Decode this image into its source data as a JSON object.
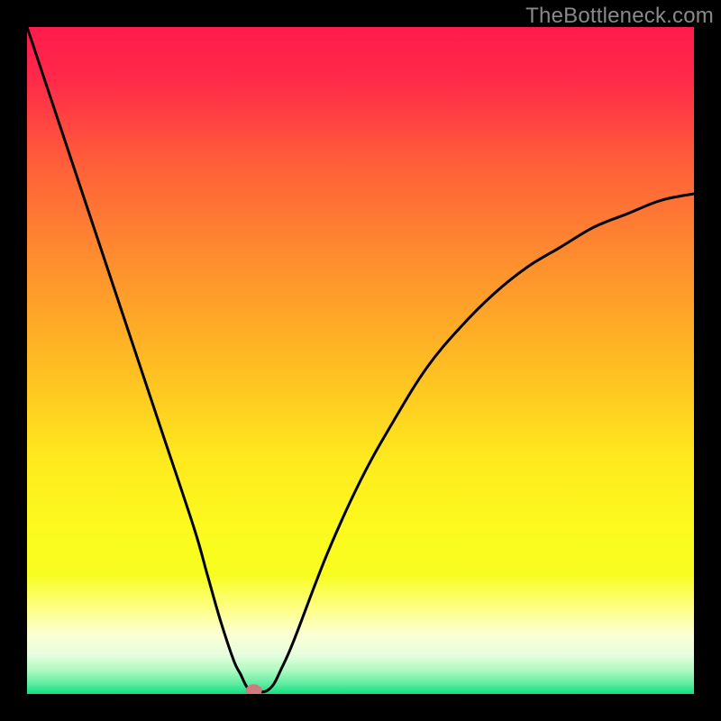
{
  "watermark": "TheBottleneck.com",
  "chart_data": {
    "type": "line",
    "title": "",
    "xlabel": "",
    "ylabel": "",
    "xlim": [
      0,
      100
    ],
    "ylim": [
      0,
      100
    ],
    "x": [
      0,
      5,
      10,
      15,
      20,
      25,
      27,
      29,
      31,
      32,
      33,
      34,
      35,
      36,
      37,
      38,
      40,
      45,
      50,
      55,
      60,
      65,
      70,
      75,
      80,
      85,
      90,
      95,
      100
    ],
    "y": [
      100,
      85,
      70,
      55,
      40,
      25,
      18,
      11,
      5,
      3,
      1,
      0.5,
      0.3,
      0.5,
      1.5,
      3.5,
      8,
      21,
      32,
      41,
      49,
      55,
      60,
      64,
      67,
      70,
      72,
      74,
      75
    ],
    "minimum_x": 34,
    "marker": {
      "x": 34,
      "y": 0.5,
      "color": "#cf7a7d"
    },
    "gradient_stops": [
      {
        "offset": 0.0,
        "color": "#ff1b4c"
      },
      {
        "offset": 0.08,
        "color": "#ff2a49"
      },
      {
        "offset": 0.2,
        "color": "#ff5d3a"
      },
      {
        "offset": 0.35,
        "color": "#fe8e2e"
      },
      {
        "offset": 0.5,
        "color": "#feba23"
      },
      {
        "offset": 0.65,
        "color": "#feea1e"
      },
      {
        "offset": 0.75,
        "color": "#fcfa1e"
      },
      {
        "offset": 0.82,
        "color": "#f7fd1f"
      },
      {
        "offset": 0.87,
        "color": "#feff82"
      },
      {
        "offset": 0.91,
        "color": "#fbffd3"
      },
      {
        "offset": 0.94,
        "color": "#e7fedf"
      },
      {
        "offset": 0.965,
        "color": "#aef9c0"
      },
      {
        "offset": 0.985,
        "color": "#5deca0"
      },
      {
        "offset": 1.0,
        "color": "#0de083"
      }
    ]
  }
}
